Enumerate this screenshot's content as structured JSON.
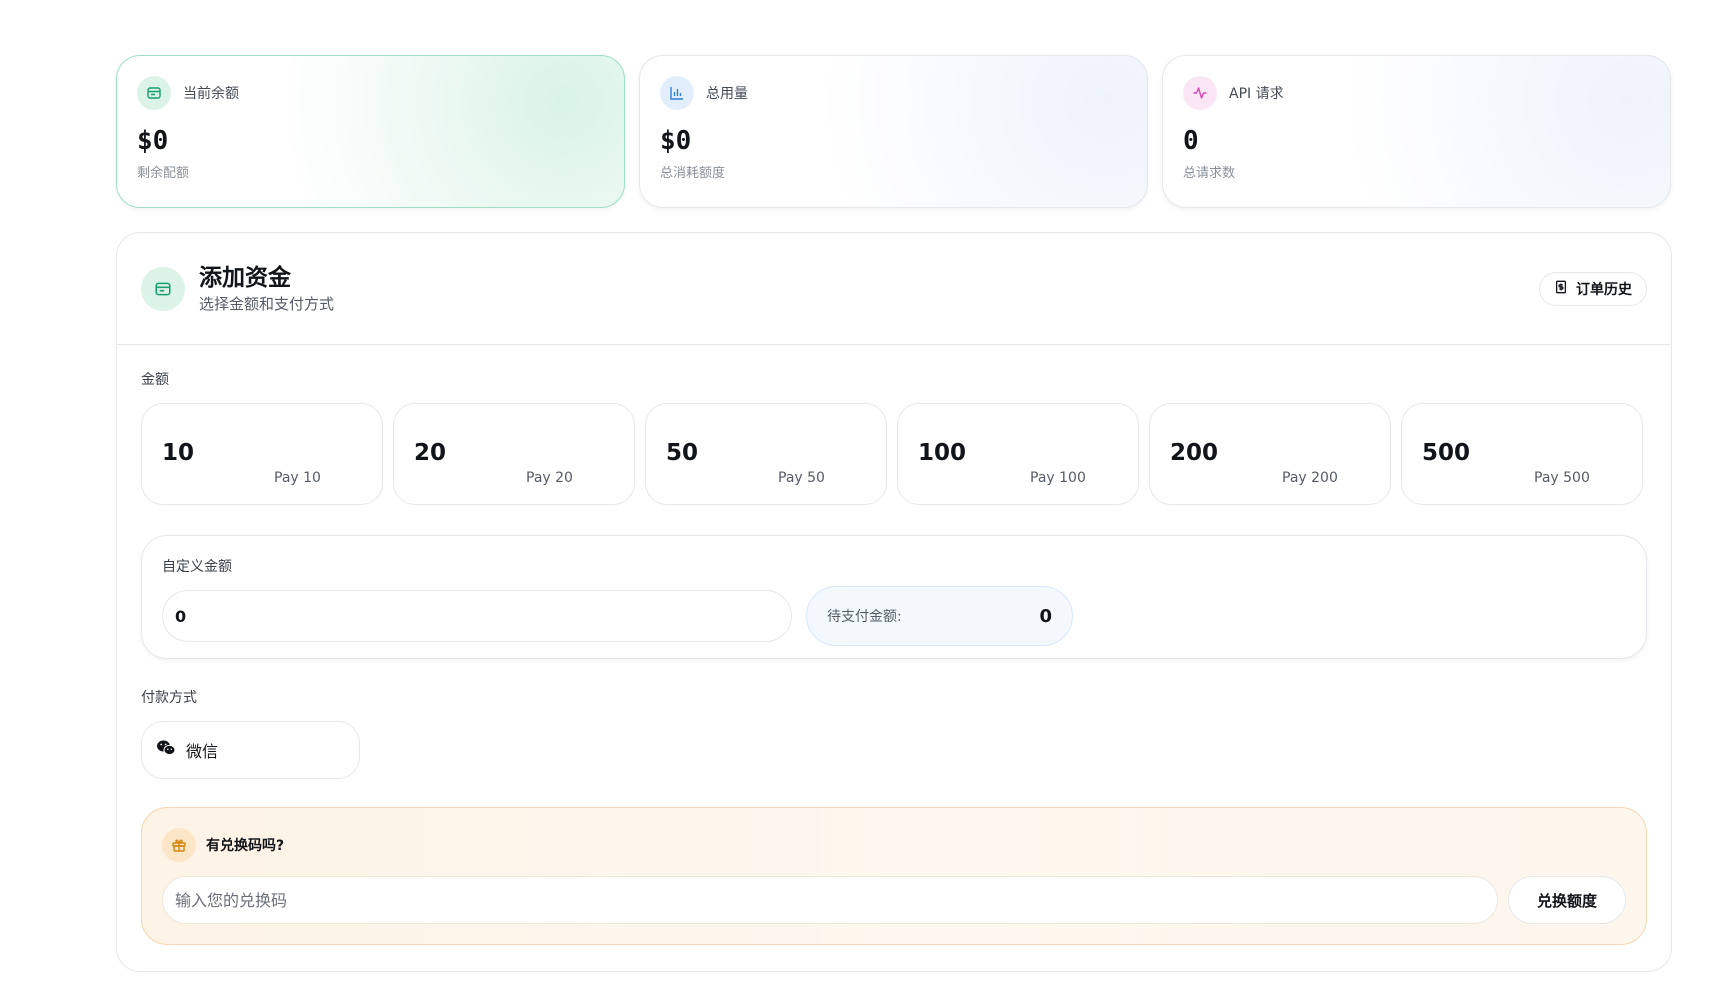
{
  "stats": [
    {
      "icon": "wallet-icon",
      "label": "当前余额",
      "value": "$0",
      "sub": "剩余配额"
    },
    {
      "icon": "bar-chart-icon",
      "label": "总用量",
      "value": "$0",
      "sub": "总消耗额度"
    },
    {
      "icon": "activity-icon",
      "label": "API 请求",
      "value": "0",
      "sub": "总请求数"
    }
  ],
  "topup": {
    "title": "添加资金",
    "subtitle": "选择金额和支付方式",
    "history_label": "订单历史",
    "amount_label": "金额",
    "amounts": [
      {
        "value": "10",
        "pay": "Pay 10"
      },
      {
        "value": "20",
        "pay": "Pay 20"
      },
      {
        "value": "50",
        "pay": "Pay 50"
      },
      {
        "value": "100",
        "pay": "Pay 100"
      },
      {
        "value": "200",
        "pay": "Pay 200"
      },
      {
        "value": "500",
        "pay": "Pay 500"
      }
    ],
    "custom_label": "自定义金额",
    "custom_value": "0",
    "pending_label": "待支付金额:",
    "pending_value": "0",
    "method_label": "付款方式",
    "methods": [
      {
        "icon": "wechat-icon",
        "label": "微信"
      }
    ]
  },
  "redeem": {
    "title": "有兑换码吗?",
    "placeholder": "输入您的兑换码",
    "button_label": "兑换额度"
  },
  "colors": {
    "accent_green": "#16a06b",
    "accent_blue": "#2f7fd6",
    "accent_pink": "#d946b6",
    "accent_orange": "#d4860d"
  }
}
